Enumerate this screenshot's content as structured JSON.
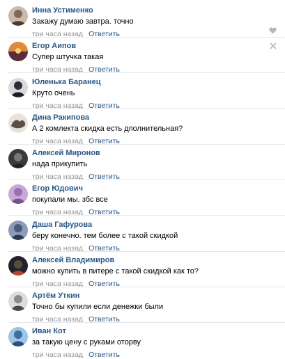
{
  "comments": [
    {
      "author": "Инна Устименко",
      "text": "Закажу думаю завтра. точно",
      "time": "три часа назад",
      "reply": "Ответить",
      "avatar": "#7c6a5f"
    },
    {
      "author": "Егор Аипов",
      "text": "Супер штучка такая",
      "time": "три часа назад",
      "reply": "Ответить",
      "avatar": "#c4532a"
    },
    {
      "author": "Юленька Баранец",
      "text": "Круто очень",
      "time": "три часа назад",
      "reply": "Ответить",
      "avatar": "#2d2d35"
    },
    {
      "author": "Дина Ракипова",
      "text": "А 2 комлекта скидка есть дполнительная?",
      "time": "три часа назад",
      "reply": "Ответить",
      "avatar": "#5a4f44"
    },
    {
      "author": "Алексей Миронов",
      "text": "нада прикупить",
      "time": "три часа назад",
      "reply": "Ответить",
      "avatar": "#3a3a3a"
    },
    {
      "author": "Егор Юдович",
      "text": "покупали мы. збс все",
      "time": "три часа назад",
      "reply": "Ответить",
      "avatar": "#9b6fb0"
    },
    {
      "author": "Даша Гафурова",
      "text": "беру конечно. тем более с такой скидкой",
      "time": "три часа назад",
      "reply": "Ответить",
      "avatar": "#4a5a7a"
    },
    {
      "author": "Алексей Владимиров",
      "text": "можно купить в питере с такой скидкой как то?",
      "time": "три часа назад",
      "reply": "Ответить",
      "avatar": "#22232a"
    },
    {
      "author": "Артём Уткин",
      "text": "Точно бы купили если денежки были",
      "time": "три часа назад",
      "reply": "Ответить",
      "avatar": "#8a8a8a"
    },
    {
      "author": "Иван Кот",
      "text": "за такую цену с руками оторву",
      "time": "три часа назад",
      "reply": "Ответить",
      "avatar": "#3b6fa0"
    }
  ],
  "icons": {
    "like": "heart-icon",
    "close": "close-icon"
  },
  "colors": {
    "author": "#2a5885",
    "time": "#939393",
    "separator": "#e7e8ec"
  }
}
